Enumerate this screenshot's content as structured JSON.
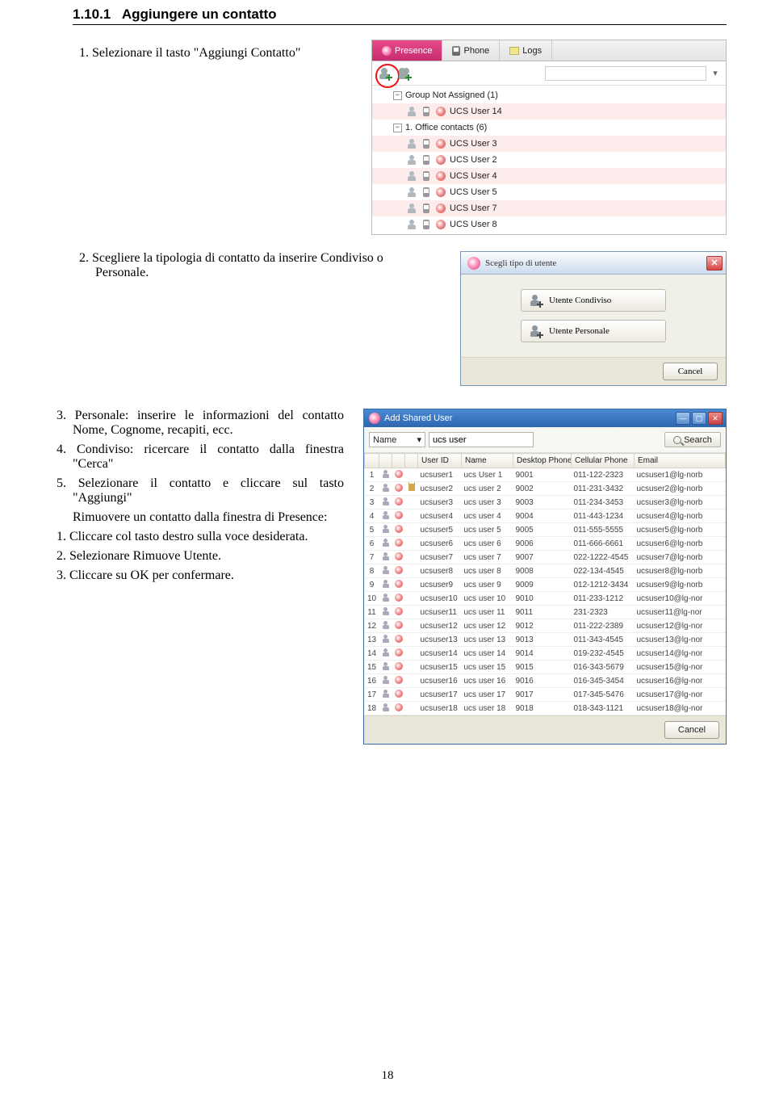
{
  "heading_num": "1.10.1",
  "heading_text": "Aggiungere un contatto",
  "step1": "1.  Selezionare il tasto \"Aggiungi Contatto\"",
  "step2": "2.  Scegliere la tipologia di contatto da inserire Condiviso o Personale.",
  "step3": "3. Personale: inserire le informazioni del contatto Nome, Cognome, recapiti, ecc.",
  "step4": "4. Condiviso: ricercare il contatto dalla finestra \"Cerca\"",
  "step5": "5. Selezionare il contatto e cliccare sul tasto \"Aggiungi\"",
  "remove_intro": "Rimuovere un contatto dalla finestra di Presence:",
  "rm1": "1. Cliccare col tasto destro sulla voce desiderata.",
  "rm2": "2.  Selezionare Rimuove Utente.",
  "rm3": "3.  Cliccare su    OK per confermare.",
  "page_number": "18",
  "presence": {
    "tabs": {
      "presence": "Presence",
      "phone": "Phone",
      "logs": "Logs"
    },
    "search_placeholder": "",
    "groups": [
      {
        "label": "Group Not Assigned (1)",
        "expanded": true,
        "items": [
          {
            "name": "UCS User 14"
          }
        ]
      },
      {
        "label": "1. Office contacts (6)",
        "expanded": true,
        "items": [
          {
            "name": "UCS User 3"
          },
          {
            "name": "UCS User 2"
          },
          {
            "name": "UCS User 4"
          },
          {
            "name": "UCS User 5"
          },
          {
            "name": "UCS User 7"
          },
          {
            "name": "UCS User 8"
          }
        ]
      }
    ]
  },
  "dialog": {
    "title": "Scegli tipo di utente",
    "btn_shared": "Utente Condiviso",
    "btn_personal": "Utente Personale",
    "cancel": "Cancel"
  },
  "shared": {
    "title": "Add Shared User",
    "filter_field": "Name",
    "filter_value": "ucs user",
    "search_btn": "Search",
    "cancel": "Cancel",
    "columns": [
      "",
      "",
      "",
      "",
      "User ID",
      "Name",
      "Desktop Phone",
      "Cellular Phone",
      "Email"
    ],
    "rows": [
      {
        "n": "1",
        "uid": "ucsuser1",
        "name": "ucs User 1",
        "desk": "9001",
        "cell": "011-122-2323",
        "email": "ucsuser1@lg-norb"
      },
      {
        "n": "2",
        "uid": "ucsuser2",
        "name": "ucs user 2",
        "desk": "9002",
        "cell": "011-231-3432",
        "email": "ucsuser2@lg-norb"
      },
      {
        "n": "3",
        "uid": "ucsuser3",
        "name": "ucs user 3",
        "desk": "9003",
        "cell": "011-234-3453",
        "email": "ucsuser3@lg-norb"
      },
      {
        "n": "4",
        "uid": "ucsuser4",
        "name": "ucs user 4",
        "desk": "9004",
        "cell": "011-443-1234",
        "email": "ucsuser4@lg-norb"
      },
      {
        "n": "5",
        "uid": "ucsuser5",
        "name": "ucs user 5",
        "desk": "9005",
        "cell": "011-555-5555",
        "email": "ucsuser5@lg-norb"
      },
      {
        "n": "6",
        "uid": "ucsuser6",
        "name": "ucs user 6",
        "desk": "9006",
        "cell": "011-666-6661",
        "email": "ucsuser6@lg-norb"
      },
      {
        "n": "7",
        "uid": "ucsuser7",
        "name": "ucs user 7",
        "desk": "9007",
        "cell": "022-1222-4545",
        "email": "ucsuser7@lg-norb"
      },
      {
        "n": "8",
        "uid": "ucsuser8",
        "name": "ucs user 8",
        "desk": "9008",
        "cell": "022-134-4545",
        "email": "ucsuser8@lg-norb"
      },
      {
        "n": "9",
        "uid": "ucsuser9",
        "name": "ucs user 9",
        "desk": "9009",
        "cell": "012-1212-3434",
        "email": "ucsuser9@lg-norb"
      },
      {
        "n": "10",
        "uid": "ucsuser10",
        "name": "ucs user 10",
        "desk": "9010",
        "cell": "011-233-1212",
        "email": "ucsuser10@lg-nor"
      },
      {
        "n": "11",
        "uid": "ucsuser11",
        "name": "ucs user 11",
        "desk": "9011",
        "cell": "231-2323",
        "email": "ucsuser11@lg-nor"
      },
      {
        "n": "12",
        "uid": "ucsuser12",
        "name": "ucs user 12",
        "desk": "9012",
        "cell": "011-222-2389",
        "email": "ucsuser12@lg-nor"
      },
      {
        "n": "13",
        "uid": "ucsuser13",
        "name": "ucs user 13",
        "desk": "9013",
        "cell": "011-343-4545",
        "email": "ucsuser13@lg-nor"
      },
      {
        "n": "14",
        "uid": "ucsuser14",
        "name": "ucs user 14",
        "desk": "9014",
        "cell": "019-232-4545",
        "email": "ucsuser14@lg-nor"
      },
      {
        "n": "15",
        "uid": "ucsuser15",
        "name": "ucs user 15",
        "desk": "9015",
        "cell": "016-343-5679",
        "email": "ucsuser15@lg-nor"
      },
      {
        "n": "16",
        "uid": "ucsuser16",
        "name": "ucs user 16",
        "desk": "9016",
        "cell": "016-345-3454",
        "email": "ucsuser16@lg-nor"
      },
      {
        "n": "17",
        "uid": "ucsuser17",
        "name": "ucs user 17",
        "desk": "9017",
        "cell": "017-345-5476",
        "email": "ucsuser17@lg-nor"
      },
      {
        "n": "18",
        "uid": "ucsuser18",
        "name": "ucs user 18",
        "desk": "9018",
        "cell": "018-343-1121",
        "email": "ucsuser18@lg-nor"
      }
    ]
  }
}
